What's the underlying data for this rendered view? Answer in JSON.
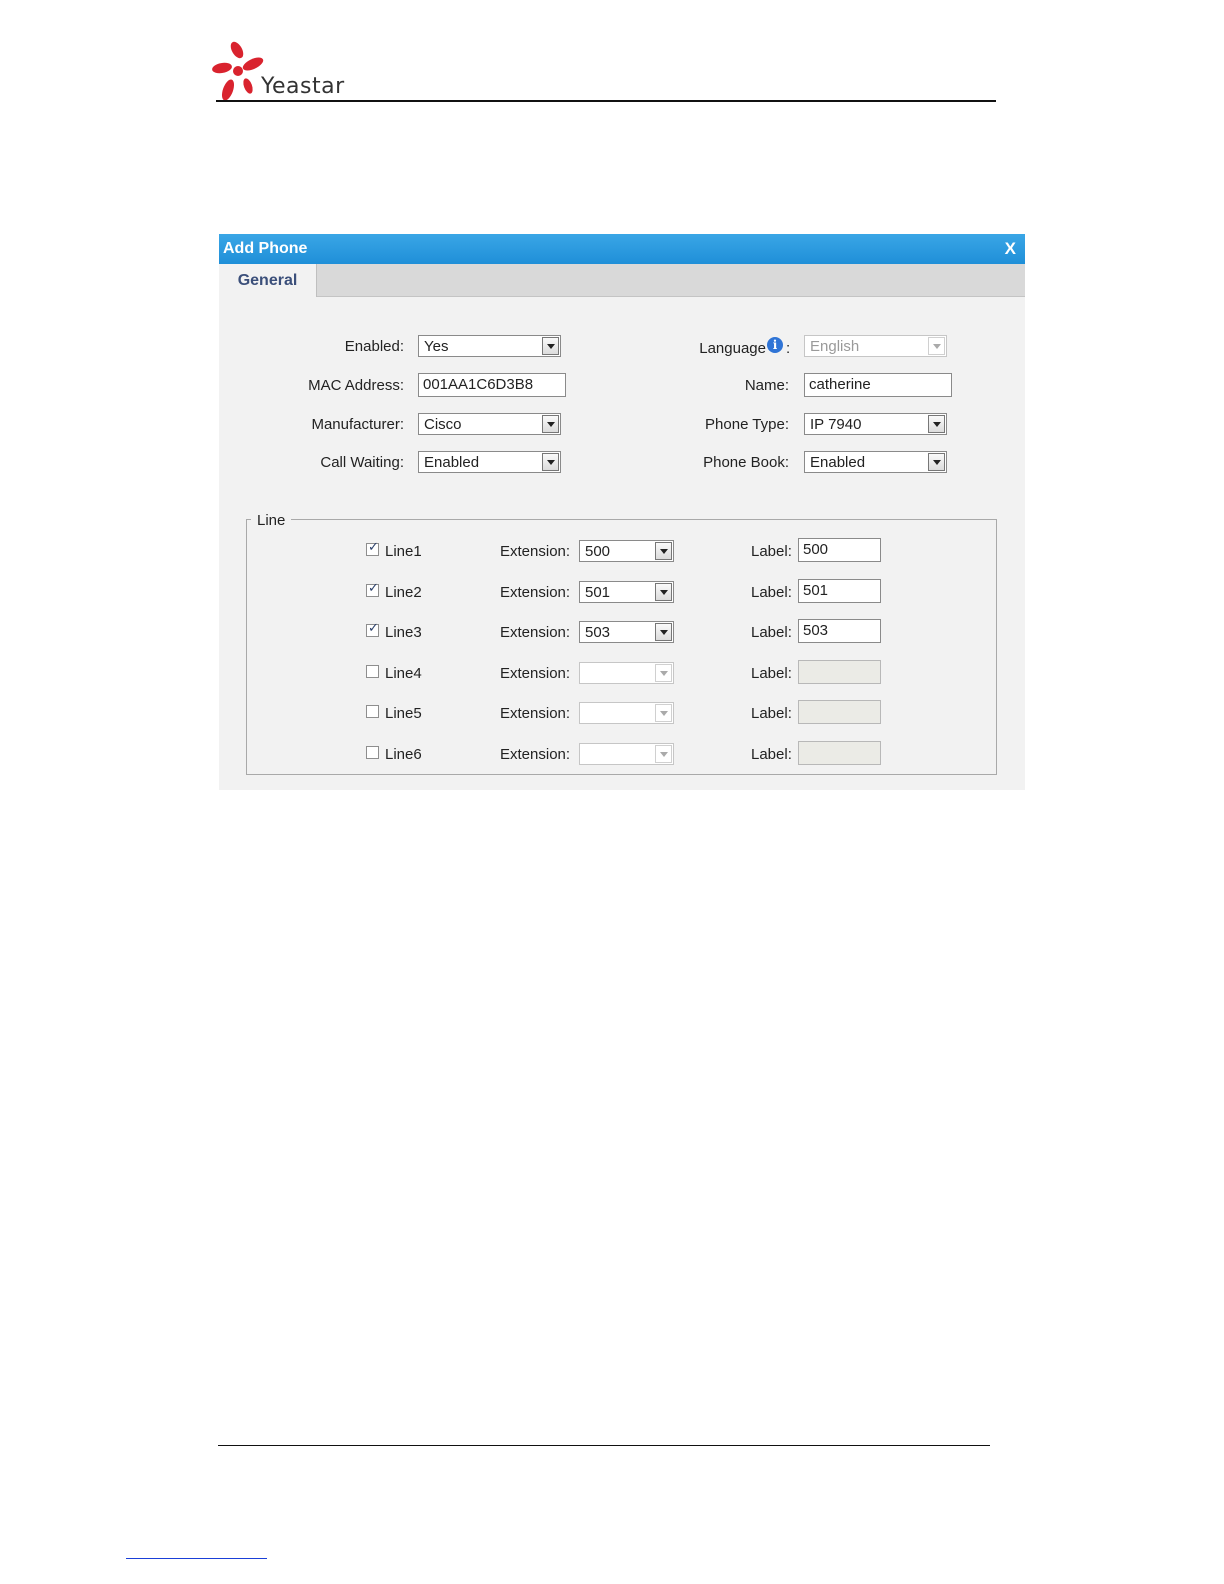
{
  "header": {
    "logo_text": "Yeastar"
  },
  "dialog": {
    "title": "Add Phone",
    "close_label": "X",
    "tabs": [
      {
        "label": "General"
      }
    ],
    "general": {
      "enabled_label": "Enabled:",
      "enabled_value": "Yes",
      "mac_label": "MAC Address:",
      "mac_value": "001AA1C6D3B8",
      "manufacturer_label": "Manufacturer:",
      "manufacturer_value": "Cisco",
      "call_waiting_label": "Call Waiting:",
      "call_waiting_value": "Enabled",
      "language_label": "Language",
      "language_colon": ":",
      "language_value": "English",
      "name_label": "Name:",
      "name_value": "catherine",
      "phone_type_label": "Phone Type:",
      "phone_type_value": "IP 7940",
      "phone_book_label": "Phone Book:",
      "phone_book_value": "Enabled"
    },
    "line_section": {
      "legend": "Line",
      "extension_label": "Extension:",
      "label_label": "Label:",
      "lines": [
        {
          "name": "Line1",
          "checked": true,
          "extension": "500",
          "label": "500"
        },
        {
          "name": "Line2",
          "checked": true,
          "extension": "501",
          "label": "501"
        },
        {
          "name": "Line3",
          "checked": true,
          "extension": "503",
          "label": "503"
        },
        {
          "name": "Line4",
          "checked": false,
          "extension": "",
          "label": ""
        },
        {
          "name": "Line5",
          "checked": false,
          "extension": "",
          "label": ""
        },
        {
          "name": "Line6",
          "checked": false,
          "extension": "",
          "label": ""
        }
      ]
    }
  },
  "colors": {
    "titlebar": "#1f8fd8",
    "tab_text": "#3b4f7a",
    "logo_red": "#d9232e",
    "info_icon": "#2f74d6"
  },
  "icons": [
    "yeastar-logo-icon",
    "info-icon",
    "close-icon",
    "chevron-down-icon",
    "checkbox-icon"
  ]
}
